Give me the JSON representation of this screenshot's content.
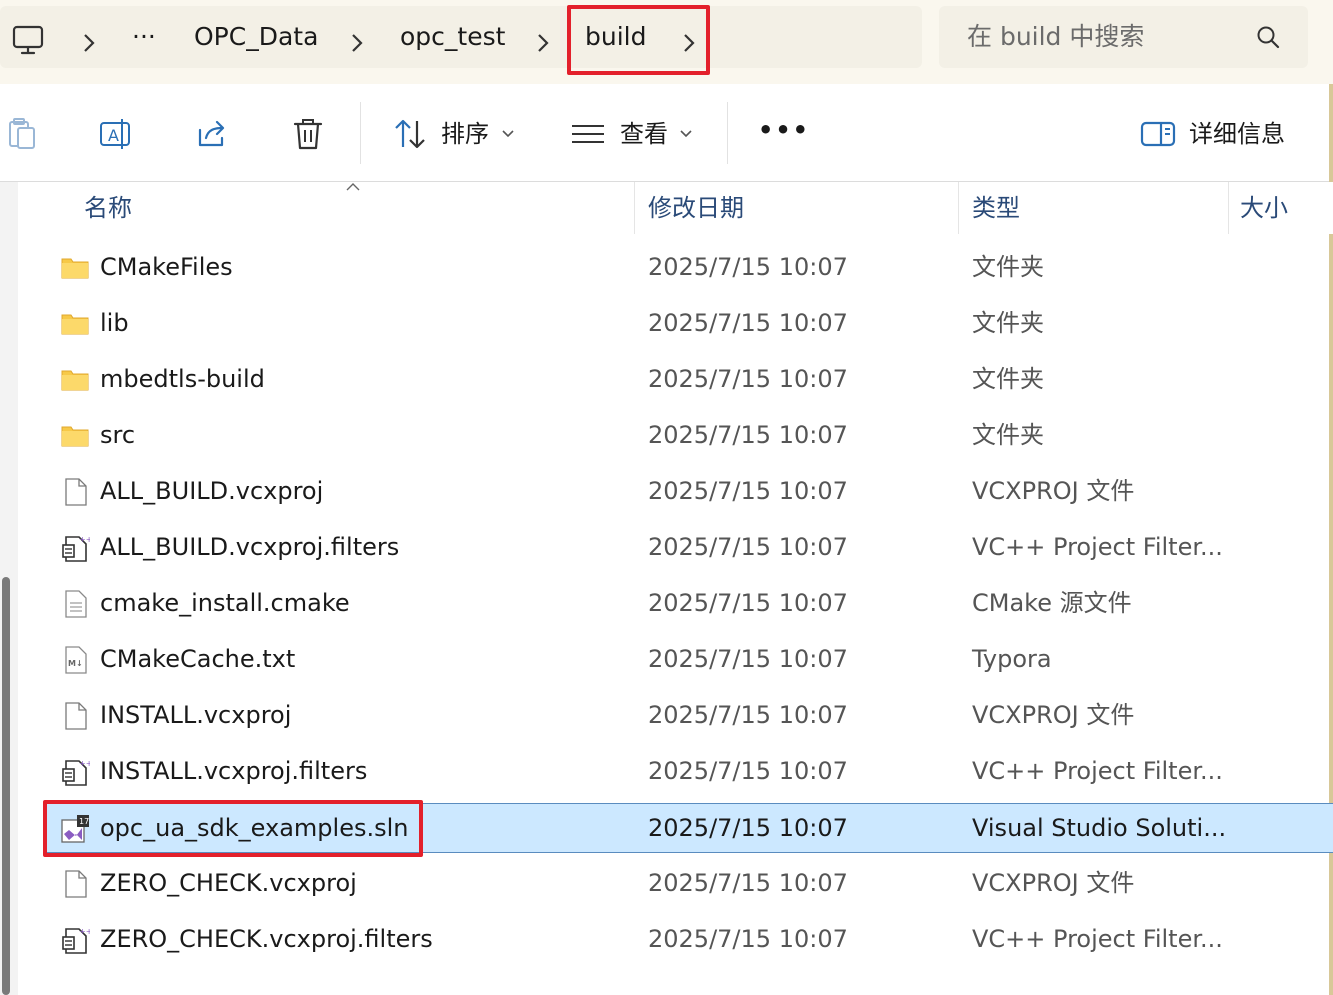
{
  "breadcrumb": {
    "items": [
      "OPC_Data",
      "opc_test",
      "build"
    ],
    "overflow": "···"
  },
  "search": {
    "placeholder": "在 build 中搜索"
  },
  "toolbar": {
    "sort_label": "排序",
    "view_label": "查看",
    "more": "•••",
    "details_label": "详细信息"
  },
  "columns": {
    "name": "名称",
    "date": "修改日期",
    "type": "类型",
    "size": "大小"
  },
  "files": [
    {
      "name": "CMakeFiles",
      "date": "2025/7/15 10:07",
      "type": "文件夹",
      "icon": "folder-icon"
    },
    {
      "name": "lib",
      "date": "2025/7/15 10:07",
      "type": "文件夹",
      "icon": "folder-icon"
    },
    {
      "name": "mbedtls-build",
      "date": "2025/7/15 10:07",
      "type": "文件夹",
      "icon": "folder-icon"
    },
    {
      "name": "src",
      "date": "2025/7/15 10:07",
      "type": "文件夹",
      "icon": "folder-icon"
    },
    {
      "name": "ALL_BUILD.vcxproj",
      "date": "2025/7/15 10:07",
      "type": "VCXPROJ 文件",
      "icon": "blank-file-icon"
    },
    {
      "name": "ALL_BUILD.vcxproj.filters",
      "date": "2025/7/15 10:07",
      "type": "VC++ Project Filter...",
      "icon": "filter-file-icon"
    },
    {
      "name": "cmake_install.cmake",
      "date": "2025/7/15 10:07",
      "type": "CMake 源文件",
      "icon": "text-file-icon"
    },
    {
      "name": "CMakeCache.txt",
      "date": "2025/7/15 10:07",
      "type": "Typora",
      "icon": "markdown-file-icon"
    },
    {
      "name": "INSTALL.vcxproj",
      "date": "2025/7/15 10:07",
      "type": "VCXPROJ 文件",
      "icon": "blank-file-icon"
    },
    {
      "name": "INSTALL.vcxproj.filters",
      "date": "2025/7/15 10:07",
      "type": "VC++ Project Filter...",
      "icon": "filter-file-icon"
    },
    {
      "name": "opc_ua_sdk_examples.sln",
      "date": "2025/7/15 10:07",
      "type": "Visual Studio Soluti...",
      "icon": "visual-studio-solution-icon",
      "selected": true
    },
    {
      "name": "ZERO_CHECK.vcxproj",
      "date": "2025/7/15 10:07",
      "type": "VCXPROJ 文件",
      "icon": "blank-file-icon"
    },
    {
      "name": "ZERO_CHECK.vcxproj.filters",
      "date": "2025/7/15 10:07",
      "type": "VC++ Project Filter...",
      "icon": "filter-file-icon"
    }
  ],
  "colors": {
    "highlight": "#e3202b",
    "selection": "#cce8ff",
    "folder": "#f7c948"
  }
}
